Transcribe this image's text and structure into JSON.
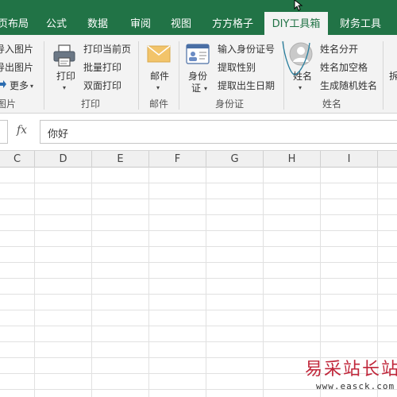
{
  "tabs": [
    {
      "id": "page-layout",
      "label": "页布局"
    },
    {
      "id": "formulas",
      "label": "公式"
    },
    {
      "id": "data",
      "label": "数据"
    },
    {
      "id": "review",
      "label": "审阅"
    },
    {
      "id": "view",
      "label": "视图"
    },
    {
      "id": "fangfang",
      "label": "方方格子"
    },
    {
      "id": "diy",
      "label": "DIY工具箱",
      "active": true
    },
    {
      "id": "finance",
      "label": "财务工具"
    }
  ],
  "ribbon": {
    "picture_group": {
      "items": [
        "导入图片",
        "导出图片",
        "更多"
      ],
      "label": "图片"
    },
    "print_group": {
      "big_button": "打印",
      "items": [
        "打印当前页",
        "批量打印",
        "双面打印"
      ],
      "label": "打印"
    },
    "mail_group": {
      "big_button": "邮件",
      "label": "邮件"
    },
    "id_group": {
      "big_button_line1": "身份",
      "big_button_line2": "证",
      "items": [
        "输入身份证号",
        "提取性别",
        "提取出生日期"
      ],
      "label": "身份证"
    },
    "name_group": {
      "big_button": "姓名",
      "items": [
        "姓名分开",
        "姓名加空格",
        "生成随机姓名"
      ],
      "label": "姓名"
    },
    "next_group_partial": "拆"
  },
  "formula_bar": {
    "fx_label": "fx",
    "value": "你好"
  },
  "columns": [
    "C",
    "D",
    "E",
    "F",
    "G",
    "H",
    "I"
  ],
  "watermark": {
    "text": "易采站长站",
    "url": "www.easck.com"
  },
  "colors": {
    "accent": "#217346",
    "ribbon_bg": "#f3f3f3",
    "watermark": "#c0263a"
  }
}
